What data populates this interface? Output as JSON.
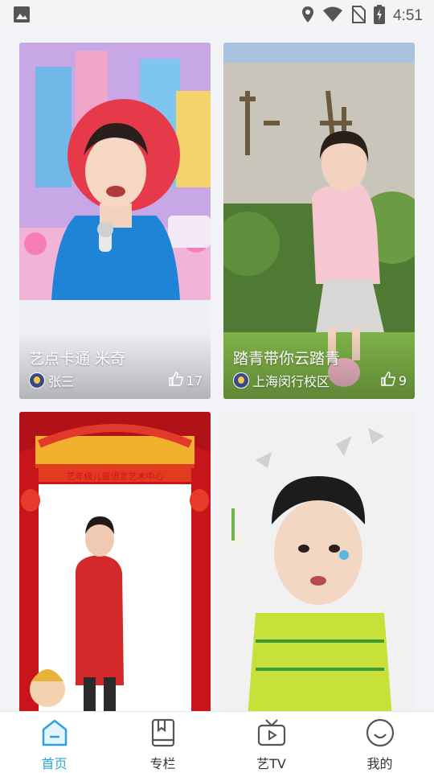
{
  "status_bar": {
    "time": "4:51",
    "icons": [
      "image-icon",
      "location-icon",
      "wifi-icon",
      "no-sim-icon",
      "battery-charging-icon"
    ]
  },
  "feed": {
    "cards": [
      {
        "title": "艺点卡通 米奇",
        "author": "张三",
        "likes": "17",
        "thumbnail": "boy-with-microphone-stage-backdrop"
      },
      {
        "title": "踏青带你云踏青",
        "author": "上海闵行校区",
        "likes": "9",
        "thumbnail": "girl-in-pink-dress-outdoors"
      },
      {
        "title": "",
        "banner_text": "艺年级儿童语言艺术中心",
        "thumbnail": "boy-in-red-costume-festive-frame"
      },
      {
        "title": "",
        "thumbnail": "boy-with-black-hat-flowers"
      }
    ]
  },
  "tabbar": {
    "items": [
      {
        "label": "首页",
        "icon": "home-icon",
        "active": true
      },
      {
        "label": "专栏",
        "icon": "book-icon",
        "active": false
      },
      {
        "label": "艺TV",
        "icon": "tv-icon",
        "active": false
      },
      {
        "label": "我的",
        "icon": "smile-face-icon",
        "active": false
      }
    ],
    "accent_color": "#2aa4e0"
  }
}
